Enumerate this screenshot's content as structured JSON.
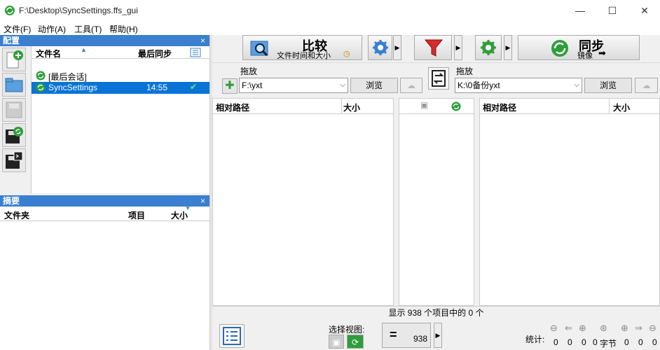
{
  "window": {
    "title": "F:\\Desktop\\SyncSettings.ffs_gui",
    "minimize": "—",
    "maximize": "☐",
    "close": "✕"
  },
  "menu": [
    "文件(F)",
    "动作(A)",
    "工具(T)",
    "帮助(H)"
  ],
  "config_panel": {
    "title": "配置",
    "close": "×",
    "col_name": "文件名",
    "col_last_sync": "最后同步",
    "rows": [
      {
        "name": "[最后会话]",
        "time": ""
      },
      {
        "name": "SyncSettings",
        "time": "14:55"
      }
    ]
  },
  "summary_panel": {
    "title": "摘要",
    "close": "×",
    "col_folder": "文件夹",
    "col_items": "项目",
    "col_size": "大小"
  },
  "toolbar": {
    "compare_label": "比较",
    "compare_sub": "文件时间和大小",
    "sync_label": "同步",
    "sync_sub": "镜像"
  },
  "left_folder": {
    "drop_label": "拖放",
    "path": "F:\\yxt",
    "browse": "浏览"
  },
  "right_folder": {
    "drop_label": "拖放",
    "path": "K:\\0备份yxt",
    "browse": "浏览"
  },
  "left_grid": {
    "col_path": "相对路径",
    "col_size": "大小"
  },
  "right_grid": {
    "col_path": "相对路径",
    "col_size": "大小"
  },
  "status": {
    "text": "显示 938 个项目中的 0 个"
  },
  "bottom": {
    "select_view": "选择视图:",
    "count": "938",
    "stats_label": "统计:",
    "stats": [
      "0",
      "0",
      "0",
      "0",
      "字节",
      "0",
      "0",
      "0"
    ]
  },
  "colors": {
    "accent": "#3a7fd0",
    "selection": "#0a74d6",
    "sync_green": "#2e9e3a",
    "filter_red": "#d62a2a"
  }
}
